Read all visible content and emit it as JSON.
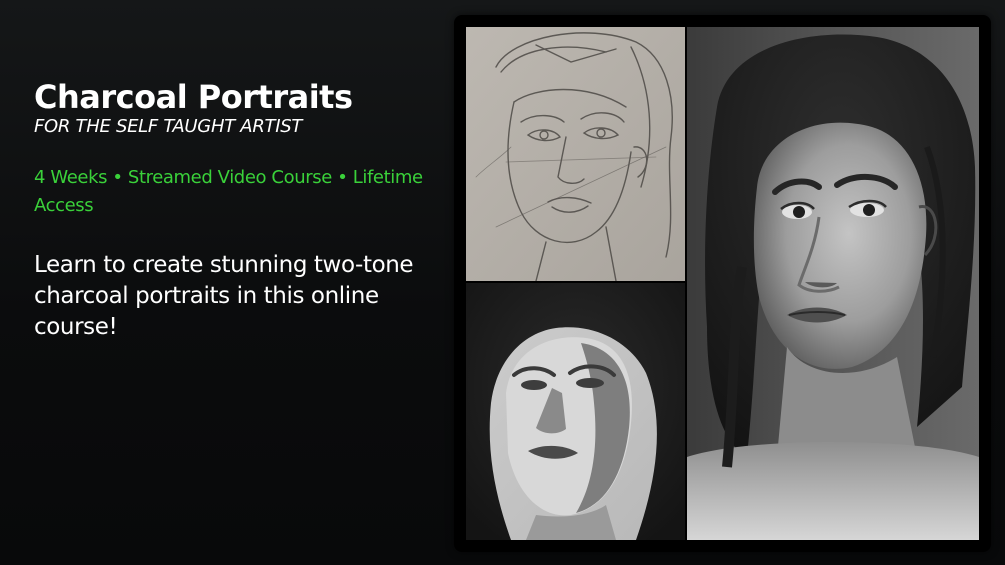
{
  "course": {
    "title": "Charcoal Portraits",
    "subtitle": "FOR THE SELF TAUGHT ARTIST",
    "meta": "4 Weeks • Streamed Video Course • Lifetime Access",
    "description": "Learn to create stunning two-tone charcoal portraits in this online course!"
  },
  "images": {
    "sketch": "pencil-sketch-portrait",
    "study": "two-tone-charcoal-study",
    "final": "finished-charcoal-portrait"
  },
  "colors": {
    "accent": "#3ad13a",
    "text": "#ffffff",
    "background": "#0b0c0d",
    "frame": "#000000"
  }
}
